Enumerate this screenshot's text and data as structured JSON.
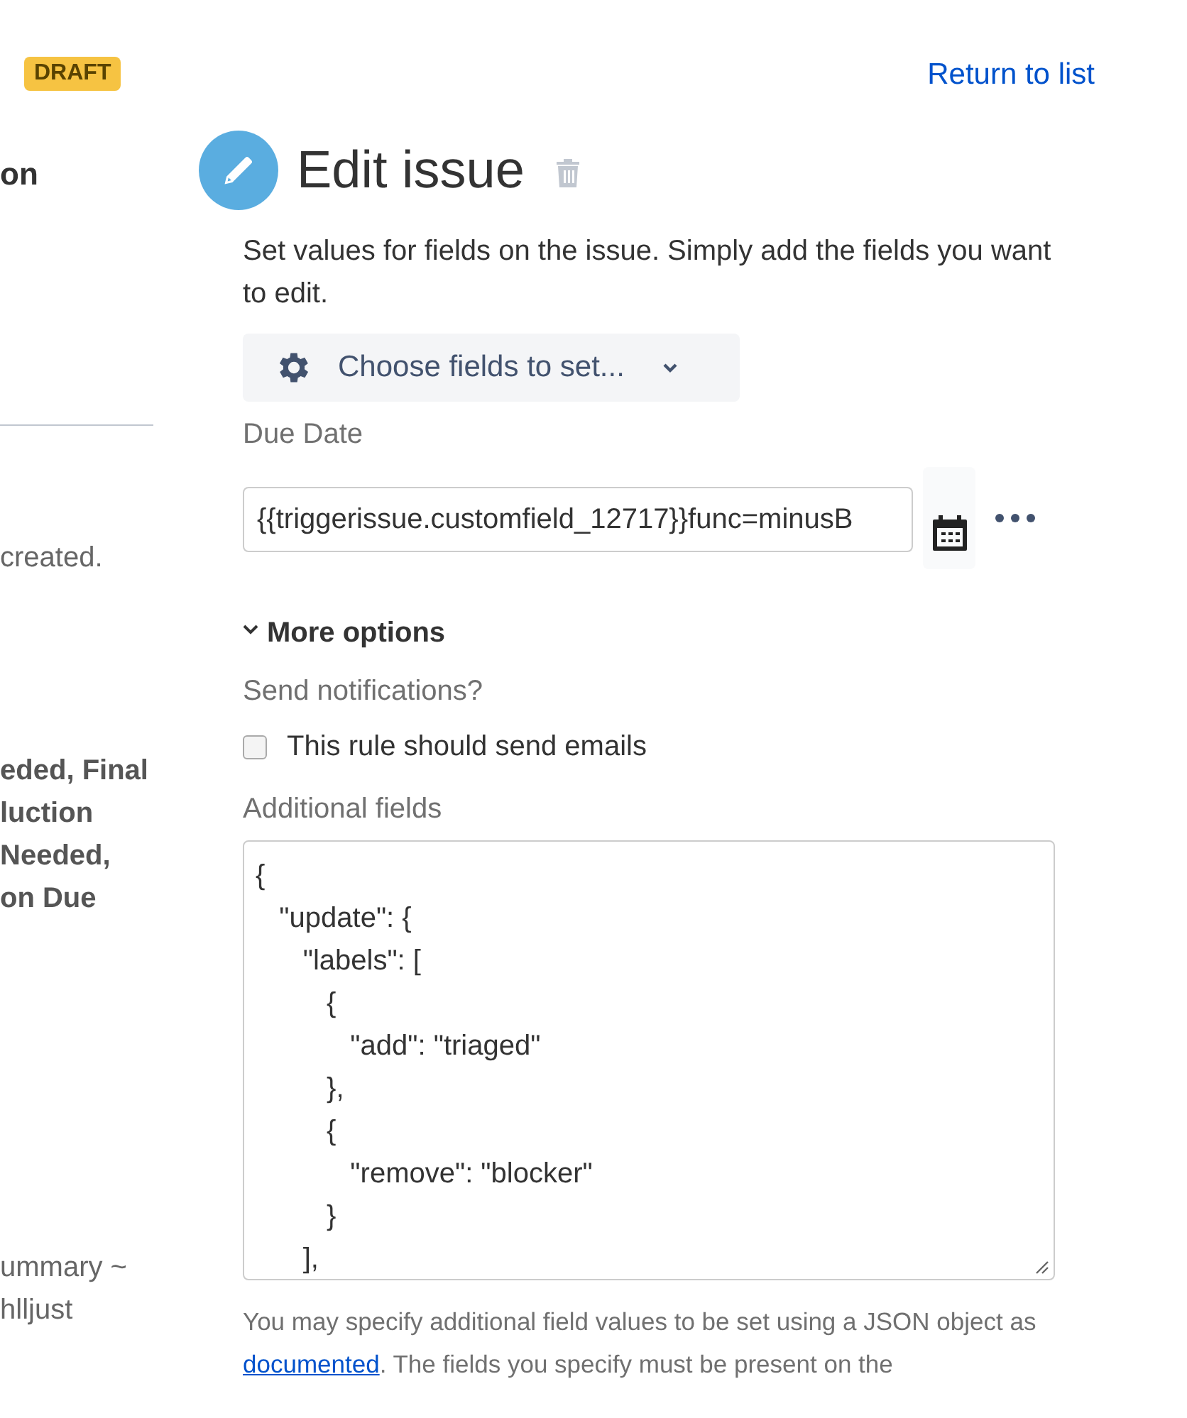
{
  "status_badge": "DRAFT",
  "return_link": "Return to list",
  "sidebar": {
    "heading": "on",
    "lines": [
      {
        "text": "created.",
        "kind": "plain"
      },
      {
        "text": "**eded**, **Final**",
        "kind": "bold"
      },
      {
        "text": "luction",
        "kind": "bold"
      },
      {
        "text": "**Needed**,",
        "kind": "bold"
      },
      {
        "text": "on Due",
        "kind": "bold"
      },
      {
        "text": "ummary ~",
        "kind": "plain"
      },
      {
        "text": "hlljust",
        "kind": "plain"
      }
    ]
  },
  "action": {
    "title": "Edit issue",
    "description": "Set values for fields on the issue. Simply add the fields you want to edit.",
    "choose_button": "Choose fields to set...",
    "fields": [
      {
        "label": "Due Date",
        "value": "{{triggerissue.customfield_12717}}func=minusB"
      }
    ],
    "more_options": {
      "label": "More options",
      "expanded": true
    },
    "notifications": {
      "label": "Send notifications?",
      "checkbox": {
        "label": "This rule should send emails",
        "checked": false
      }
    },
    "additional_fields": {
      "label": "Additional fields",
      "lines": [
        "{",
        "   \"update\": {",
        "      \"labels\": [",
        "         {",
        "            \"add\": \"triaged\"",
        "         },",
        "         {",
        "            \"remove\": \"blocker\"",
        "         }",
        "      ],"
      ]
    },
    "help": {
      "before": "You may specify additional field values to be set using a JSON object as",
      "link": "documented",
      "after": ". The fields you specify must be present on the"
    }
  }
}
